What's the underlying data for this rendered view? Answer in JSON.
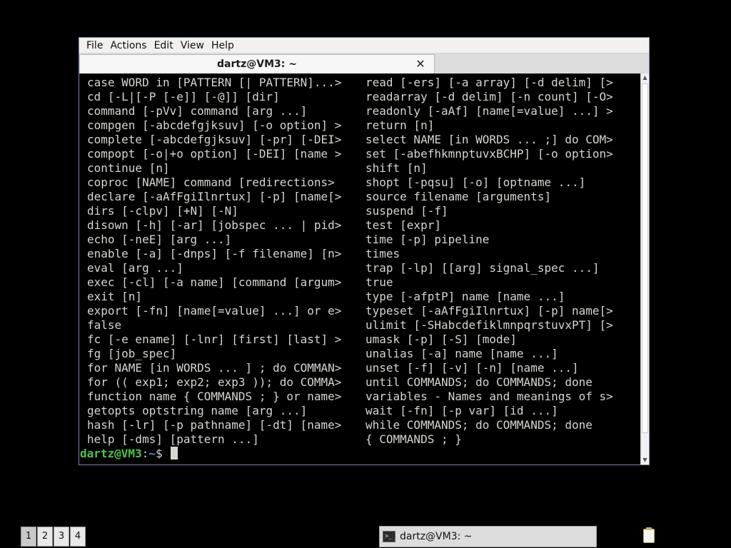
{
  "menubar": {
    "items": [
      "File",
      "Actions",
      "Edit",
      "View",
      "Help"
    ]
  },
  "tab": {
    "title": "dartz@VM3: ~",
    "close_icon": "close-icon"
  },
  "terminal": {
    "left_column": [
      "case WORD in [PATTERN [| PATTERN]...>",
      "cd [-L|[-P [-e]] [-@]] [dir]",
      "command [-pVv] command [arg ...]",
      "compgen [-abcdefgjksuv] [-o option] >",
      "complete [-abcdefgjksuv] [-pr] [-DEI>",
      "compopt [-o|+o option] [-DEI] [name >",
      "continue [n]",
      "coproc [NAME] command [redirections>",
      "declare [-aAfFgiIlnrtux] [-p] [name[>",
      "dirs [-clpv] [+N] [-N]",
      "disown [-h] [-ar] [jobspec ... | pid>",
      "echo [-neE] [arg ...]",
      "enable [-a] [-dnps] [-f filename] [n>",
      "eval [arg ...]",
      "exec [-cl] [-a name] [command [argum>",
      "exit [n]",
      "export [-fn] [name[=value] ...] or e>",
      "false",
      "fc [-e ename] [-lnr] [first] [last] >",
      "fg [job_spec]",
      "for NAME [in WORDS ... ] ; do COMMAN>",
      "for (( exp1; exp2; exp3 )); do COMMA>",
      "function name { COMMANDS ; } or name>",
      "getopts optstring name [arg ...]",
      "hash [-lr] [-p pathname] [-dt] [name>",
      "help [-dms] [pattern ...]"
    ],
    "right_column": [
      "read [-ers] [-a array] [-d delim] [>",
      "readarray [-d delim] [-n count] [-O>",
      "readonly [-aAf] [name[=value] ...] >",
      "return [n]",
      "select NAME [in WORDS ... ;] do COM>",
      "set [-abefhkmnptuvxBCHP] [-o option>",
      "shift [n]",
      "shopt [-pqsu] [-o] [optname ...]",
      "source filename [arguments]",
      "suspend [-f]",
      "test [expr]",
      "time [-p] pipeline",
      "times",
      "trap [-lp] [[arg] signal_spec ...]",
      "true",
      "type [-afptP] name [name ...]",
      "typeset [-aAfFgiIlnrtux] [-p] name[>",
      "ulimit [-SHabcdefiklmnpqrstuvxPT] [>",
      "umask [-p] [-S] [mode]",
      "unalias [-a] name [name ...]",
      "unset [-f] [-v] [-n] [name ...]",
      "until COMMANDS; do COMMANDS; done",
      "variables - Names and meanings of s>",
      "wait [-fn] [-p var] [id ...]",
      "while COMMANDS; do COMMANDS; done",
      "{ COMMANDS ; }"
    ],
    "prompt": {
      "user_host": "dartz@VM3",
      "colon": ":",
      "path": "~",
      "symbol": "$ "
    },
    "colors": {
      "user": "#4ec34e",
      "path": "#5c8fe0",
      "text": "#d3d7cf",
      "background": "#000000"
    }
  },
  "taskbar": {
    "workspaces": [
      "1",
      "2",
      "3",
      "4"
    ],
    "task_label": "dartz@VM3: ~",
    "task_icon": "terminal-icon",
    "tray_icon": "clipboard-icon"
  }
}
